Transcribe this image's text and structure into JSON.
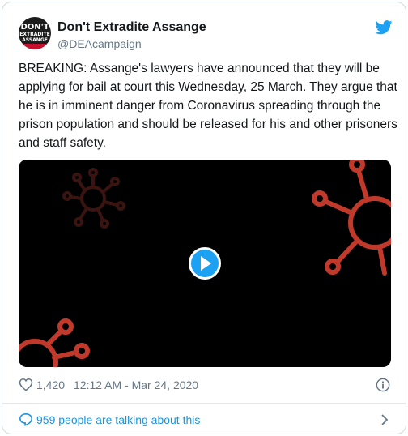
{
  "account": {
    "avatar_line1": "DON'T",
    "avatar_line2": "EXTRADITE",
    "avatar_line3": "ASSANGE",
    "display_name": "Don't Extradite Assange",
    "handle": "@DEAcampaign"
  },
  "tweet": {
    "text": "BREAKING: Assange's lawyers have announced that they will be applying for bail at court this Wednesday, 25 March. They argue that he is in imminent danger from Coronavirus spreading through the prison population and should be released for his and other prisoners and staff safety."
  },
  "media": {
    "type": "video",
    "play_icon": "play-icon"
  },
  "stats": {
    "likes": "1,420",
    "timestamp": "12:12 AM - Mar 24, 2020"
  },
  "conversation": {
    "label": "959 people are talking about this"
  },
  "icons": {
    "brand": "twitter-bird-icon",
    "like": "heart-icon",
    "info": "info-icon",
    "talk": "speech-bubble-icon",
    "more": "chevron-right-icon"
  },
  "colors": {
    "twitter_blue": "#1da1f2",
    "link_blue": "#1b95e0",
    "muted": "#657786",
    "virus_red": "#c0392b",
    "video_bg": "#000000"
  }
}
